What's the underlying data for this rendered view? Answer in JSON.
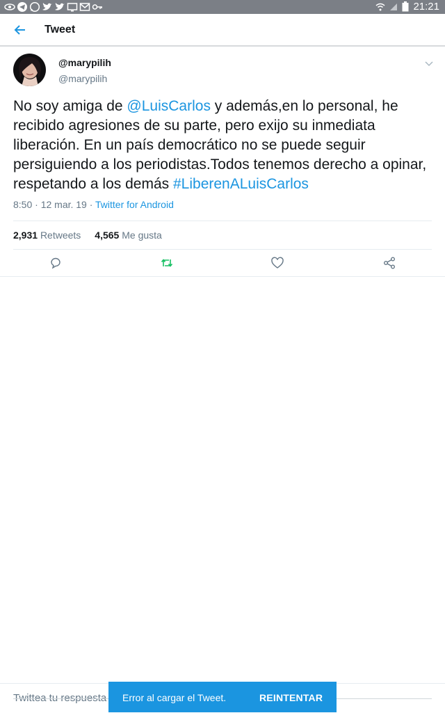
{
  "status_bar": {
    "time": "21:21",
    "icons": [
      "eye-icon",
      "telegram-icon",
      "whatsapp-icon",
      "twitter-icon",
      "twitter-icon",
      "screen-icon",
      "gmail-icon",
      "key-icon"
    ],
    "right_icons": [
      "wifi-icon",
      "signal-icon",
      "battery-icon"
    ],
    "color": "#7b7f86"
  },
  "app_bar": {
    "title": "Tweet",
    "back_icon": "arrow-left-icon"
  },
  "tweet": {
    "display_name": "@marypilih",
    "handle": "@marypilih",
    "text_parts": [
      {
        "t": "No soy amiga de ",
        "link": false
      },
      {
        "t": "@LuisCarlos",
        "link": true
      },
      {
        "t": " y además,en lo personal, he recibido agresiones de su parte, pero exijo su inmediata liberación. En un país democrático no se puede seguir persiguiendo a los periodistas.Todos tenemos derecho a opinar, respetando a los demás ",
        "link": false
      },
      {
        "t": "#LiberenALuisCarlos",
        "link": true
      }
    ],
    "time_date": "8:50 · 12 mar. 19 · ",
    "source": "Twitter for Android",
    "retweets_count": "2,931",
    "retweets_label": "Retweets",
    "likes_count": "4,565",
    "likes_label": "Me gusta",
    "link_color": "#1b95e0"
  },
  "actions": [
    "reply-icon",
    "retweet-icon",
    "like-icon",
    "share-icon"
  ],
  "reply": {
    "placeholder": "Twittea tu respuesta"
  },
  "snackbar": {
    "message": "Error al cargar el Tweet.",
    "action": "REINTENTAR",
    "color": "#1b95e0"
  }
}
